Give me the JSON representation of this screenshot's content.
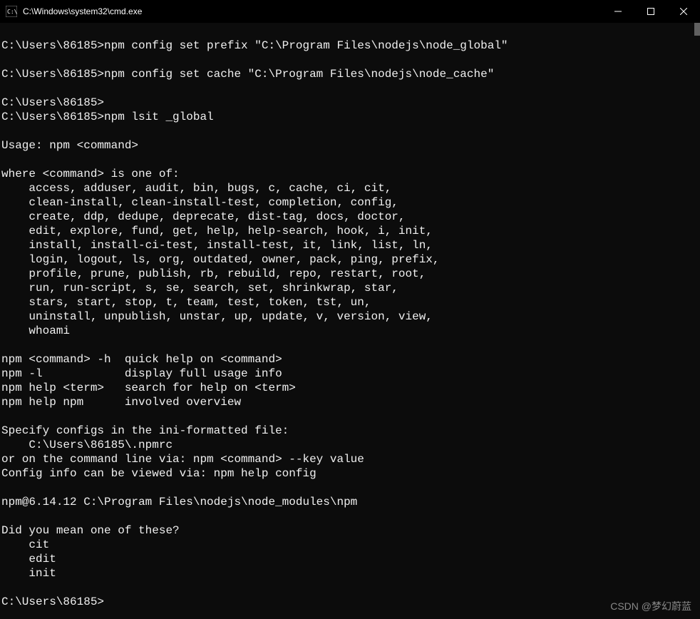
{
  "titlebar": {
    "title": "C:\\Windows\\system32\\cmd.exe"
  },
  "terminal": {
    "lines": [
      "",
      "C:\\Users\\86185>npm config set prefix \"C:\\Program Files\\nodejs\\node_global\"",
      "",
      "C:\\Users\\86185>npm config set cache \"C:\\Program Files\\nodejs\\node_cache\"",
      "",
      "C:\\Users\\86185>",
      "C:\\Users\\86185>npm lsit _global",
      "",
      "Usage: npm <command>",
      "",
      "where <command> is one of:",
      "    access, adduser, audit, bin, bugs, c, cache, ci, cit,",
      "    clean-install, clean-install-test, completion, config,",
      "    create, ddp, dedupe, deprecate, dist-tag, docs, doctor,",
      "    edit, explore, fund, get, help, help-search, hook, i, init,",
      "    install, install-ci-test, install-test, it, link, list, ln,",
      "    login, logout, ls, org, outdated, owner, pack, ping, prefix,",
      "    profile, prune, publish, rb, rebuild, repo, restart, root,",
      "    run, run-script, s, se, search, set, shrinkwrap, star,",
      "    stars, start, stop, t, team, test, token, tst, un,",
      "    uninstall, unpublish, unstar, up, update, v, version, view,",
      "    whoami",
      "",
      "npm <command> -h  quick help on <command>",
      "npm -l            display full usage info",
      "npm help <term>   search for help on <term>",
      "npm help npm      involved overview",
      "",
      "Specify configs in the ini-formatted file:",
      "    C:\\Users\\86185\\.npmrc",
      "or on the command line via: npm <command> --key value",
      "Config info can be viewed via: npm help config",
      "",
      "npm@6.14.12 C:\\Program Files\\nodejs\\node_modules\\npm",
      "",
      "Did you mean one of these?",
      "    cit",
      "    edit",
      "    init",
      "",
      "C:\\Users\\86185>"
    ]
  },
  "watermark": "CSDN @梦幻蔚蓝"
}
